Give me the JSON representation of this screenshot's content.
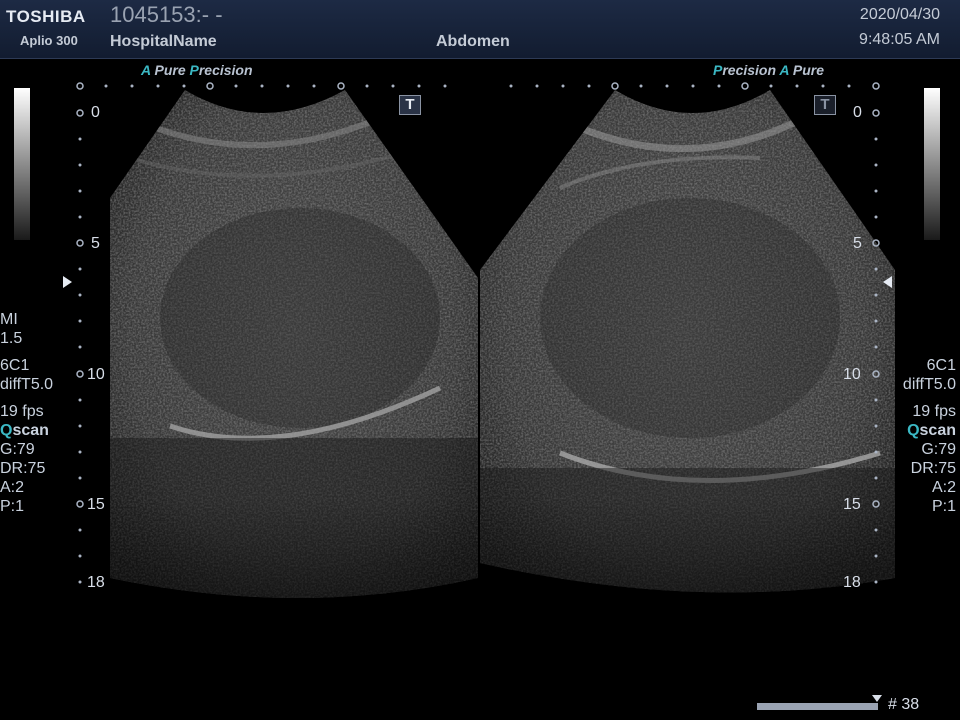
{
  "header": {
    "brand": "TOSHIBA",
    "model": "Aplio 300",
    "patient_id": "1045153:- -",
    "hospital": "HospitalName",
    "exam": "Abdomen",
    "date": "2020/04/30",
    "time": "9:48:05 AM"
  },
  "left_image": {
    "label_a": "A",
    "label_pure": "Pure",
    "label_p": "P",
    "label_precision": "recision",
    "mode_button": "T"
  },
  "right_image": {
    "label_p": "P",
    "label_precision": "recision",
    "label_a": "A",
    "label_pure": "Pure",
    "mode_button": "T"
  },
  "depth_scale": {
    "left_ticks": [
      "0",
      "5",
      "10",
      "15",
      "18"
    ],
    "right_ticks": [
      "0",
      "5",
      "10",
      "15",
      "18"
    ]
  },
  "left_params": {
    "mi_label": "MI",
    "mi_value": "1.5",
    "probe": "6C1",
    "preset": "diffT5.0",
    "fps": "19 fps",
    "qscan_q": "Q",
    "qscan_rest": "scan",
    "gain": "G:79",
    "dr": "DR:75",
    "a": "A:2",
    "p": "P:1"
  },
  "right_params": {
    "probe": "6C1",
    "preset": "diffT5.0",
    "fps": "19 fps",
    "qscan_q": "Q",
    "qscan_rest": "scan",
    "gain": "G:79",
    "dr": "DR:75",
    "a": "A:2",
    "p": "P:1"
  },
  "cine": {
    "frame_label": "# 38"
  },
  "colors": {
    "accent": "#3bb8c4",
    "header_bg": "#1d2a44",
    "text": "#c9d2de"
  }
}
